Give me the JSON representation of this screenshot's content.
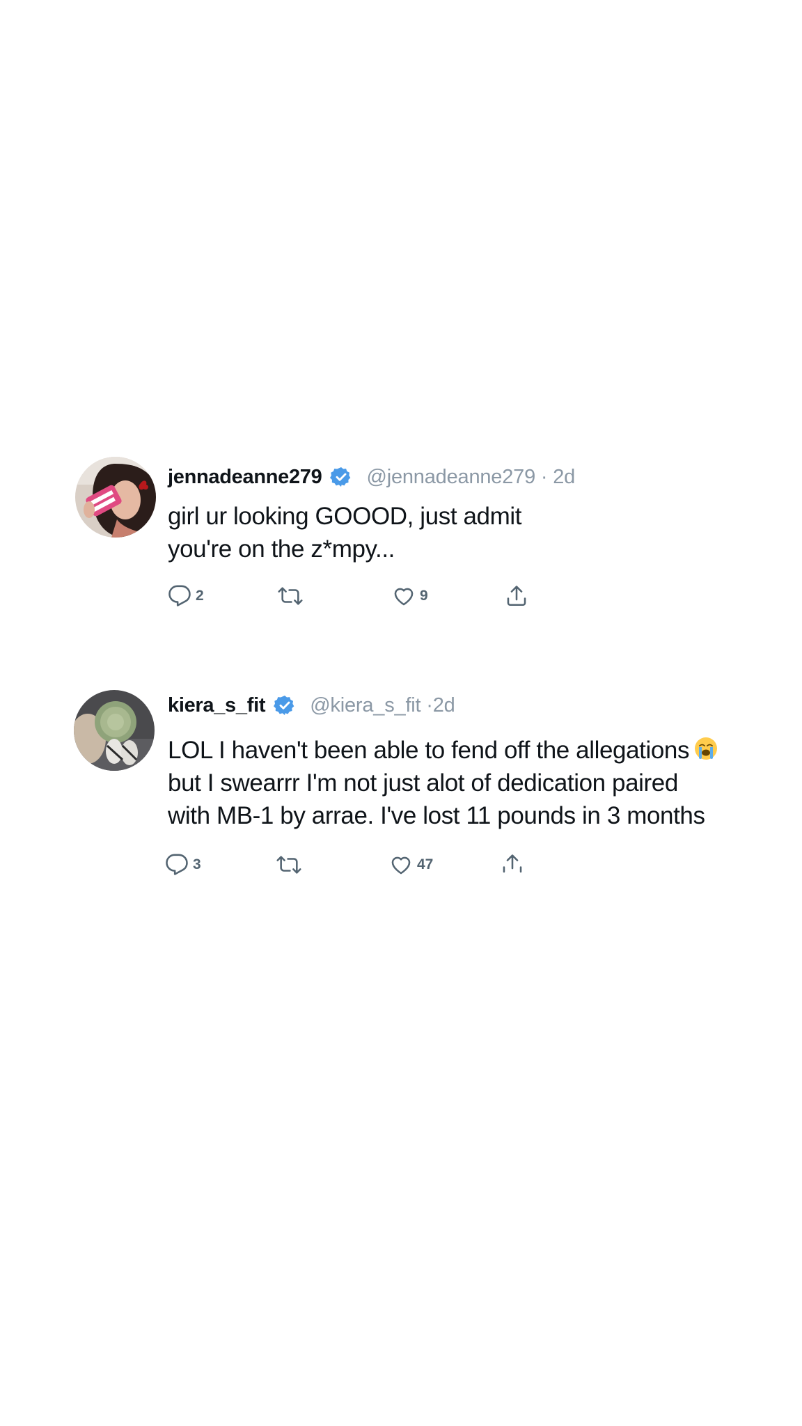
{
  "tweets": [
    {
      "username": "jennadeanne279",
      "handle_time": "@jennadeanne279 · 2d",
      "lines": [
        "girl ur looking GOOOD, just admit",
        "you're on the z*mpy..."
      ],
      "reply_count": "2",
      "retweet_count": "",
      "like_count": "9"
    },
    {
      "username": "kiera_s_fit",
      "handle_time": "@kiera_s_fit ·2d",
      "lines": [
        "LOL I haven't been able to fend off the allegations",
        "but I swearrr I'm not just alot of dedication paired",
        "with MB-1 by arrae. I've lost 11 pounds in 3 months"
      ],
      "emoji": "😭",
      "reply_count": "3",
      "retweet_count": "",
      "like_count": "47"
    }
  ],
  "colors": {
    "verified": "#4a9ae8",
    "text": "#0f1419",
    "muted": "#8b98a5",
    "icon": "#536471"
  },
  "icons": [
    "verified-badge-icon",
    "reply-icon",
    "retweet-icon",
    "like-icon",
    "share-icon",
    "loudly-crying-face-emoji"
  ]
}
